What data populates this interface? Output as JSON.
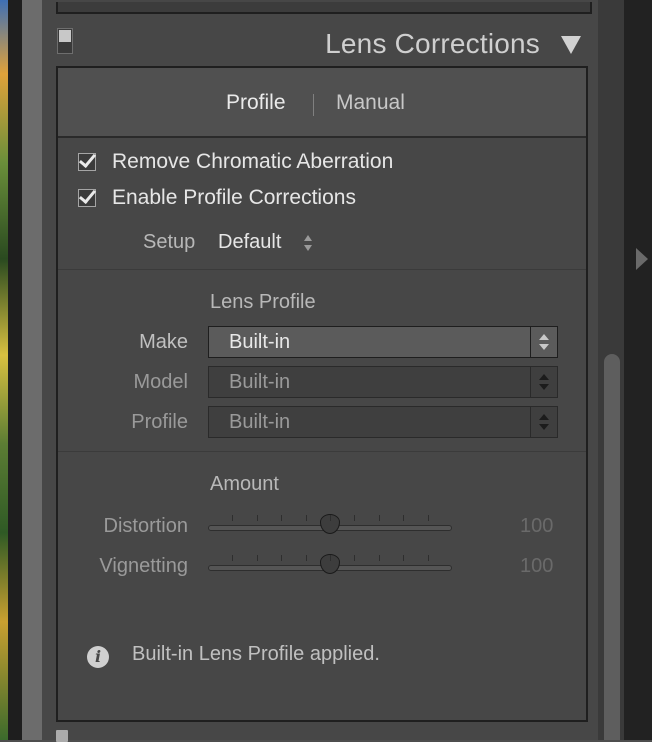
{
  "panel": {
    "title": "Lens Corrections"
  },
  "tabs": [
    {
      "label": "Profile",
      "active": true
    },
    {
      "label": "Manual",
      "active": false
    }
  ],
  "checkboxes": [
    {
      "label": "Remove Chromatic Aberration",
      "checked": true
    },
    {
      "label": "Enable Profile Corrections",
      "checked": true
    }
  ],
  "setup": {
    "label": "Setup",
    "value": "Default"
  },
  "lens_profile": {
    "title": "Lens Profile",
    "fields": [
      {
        "label": "Make",
        "value": "Built-in",
        "enabled": true
      },
      {
        "label": "Model",
        "value": "Built-in",
        "enabled": false
      },
      {
        "label": "Profile",
        "value": "Built-in",
        "enabled": false
      }
    ]
  },
  "amount": {
    "title": "Amount",
    "sliders": [
      {
        "label": "Distortion",
        "value": "100",
        "level": 0.5
      },
      {
        "label": "Vignetting",
        "value": "100",
        "level": 0.5
      }
    ]
  },
  "info": {
    "text": "Built-in Lens Profile applied."
  }
}
